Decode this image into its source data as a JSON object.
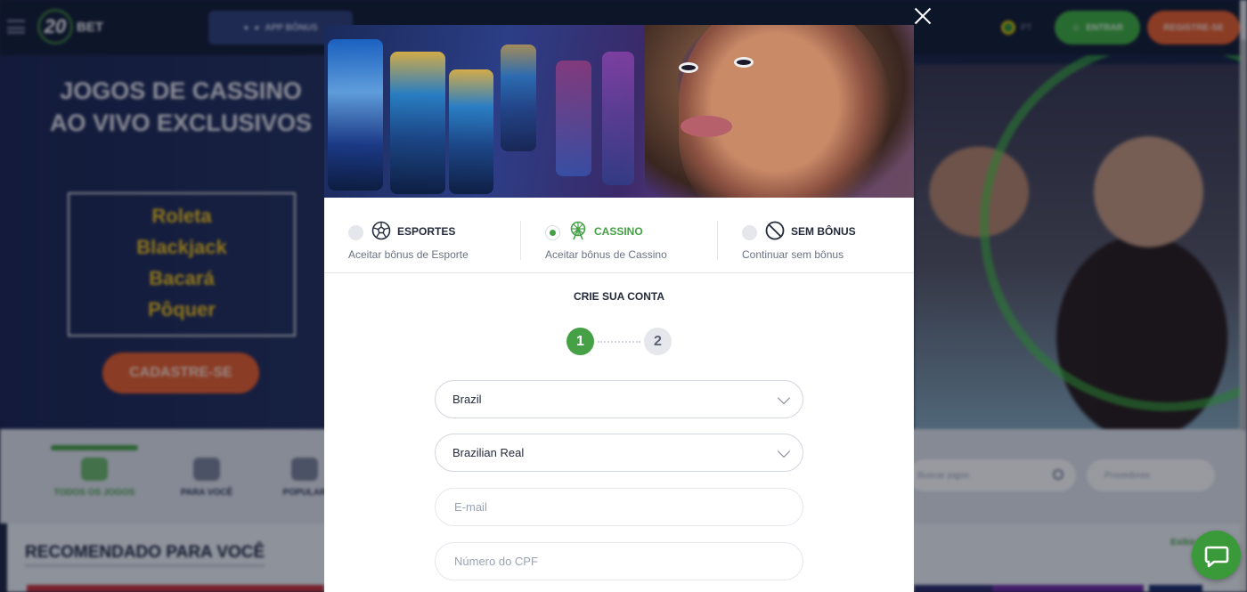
{
  "header": {
    "logo_number": "20",
    "logo_text": "BET",
    "app_button": "APP BÔNUS",
    "lang": "PT",
    "login_button": "ENTRAR",
    "register_button": "REGISTRE-SE"
  },
  "hero": {
    "title": "JOGOS DE CASSINO AO VIVO EXCLUSIVOS",
    "games": [
      "Roleta",
      "Blackjack",
      "Bacará",
      "Pôquer"
    ],
    "cta": "CADASTRE-SE"
  },
  "categories": {
    "items": [
      "TODOS OS JOGOS",
      "PARA VOCÊ",
      "POPULAR"
    ],
    "search_placeholder": "Buscar jogos",
    "promo_placeholder": "Provedores"
  },
  "recommended": {
    "title": "RECOMENDADO PARA VOCÊ",
    "link": "Exibir todos"
  },
  "modal": {
    "bonus_options": [
      {
        "title": "ESPORTES",
        "subtitle": "Aceitar bônus de Esporte",
        "selected": false,
        "icon": "soccer-ball-icon"
      },
      {
        "title": "CASSINO",
        "subtitle": "Aceitar bônus de Cassino",
        "selected": true,
        "icon": "ferris-wheel-icon"
      },
      {
        "title": "SEM BÔNUS",
        "subtitle": "Continuar sem bônus",
        "selected": false,
        "icon": "no-entry-icon"
      }
    ],
    "form_title": "CRIE SUA CONTA",
    "steps": [
      "1",
      "2"
    ],
    "country": "Brazil",
    "currency": "Brazilian Real",
    "email_placeholder": "E-mail",
    "cpf_placeholder": "Número do CPF"
  },
  "colors": {
    "accent_green": "#46a046",
    "accent_orange": "#e85d2a",
    "overlay": "rgba(10,14,28,0.42)"
  }
}
